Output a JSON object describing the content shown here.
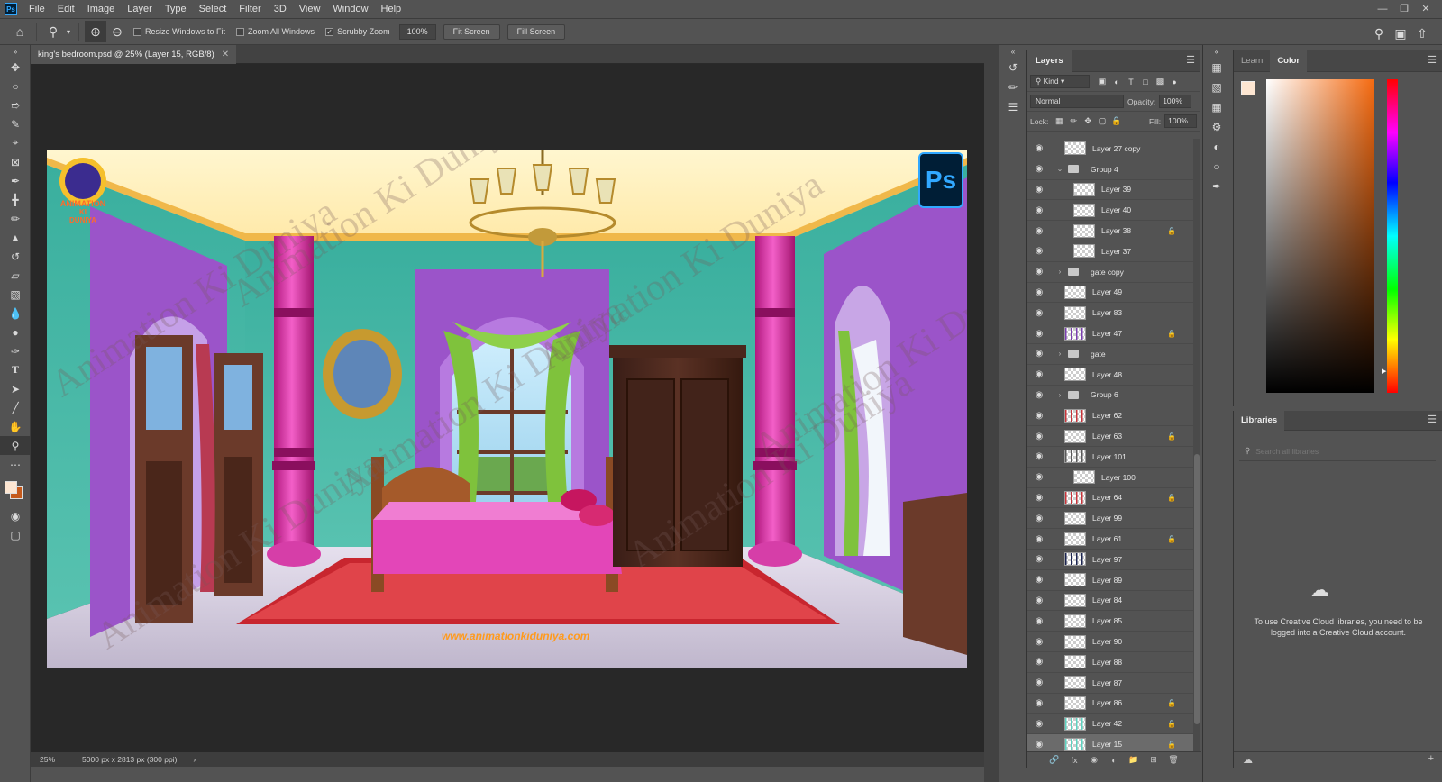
{
  "app": {
    "logo_text": "Ps"
  },
  "menu": [
    "File",
    "Edit",
    "Image",
    "Layer",
    "Type",
    "Select",
    "Filter",
    "3D",
    "View",
    "Window",
    "Help"
  ],
  "options": {
    "resize_windows": "Resize Windows to Fit",
    "zoom_all": "Zoom All Windows",
    "scrubby_zoom": "Scrubby Zoom",
    "zoom_value": "100%",
    "fit_screen": "Fit Screen",
    "fill_screen": "Fill Screen",
    "resize_checked": false,
    "zoom_all_checked": false,
    "scrubby_checked": true
  },
  "document": {
    "tab_title": "king's bedroom.psd @ 25% (Layer 15, RGB/8)",
    "status_zoom": "25%",
    "status_info": "5000 px x 2813 px (300 ppi)",
    "watermark_text": "Animation Ki Duniya",
    "ps_badge": "Ps",
    "site_url": "www.animationkiduniya.com",
    "logo_line1": "ANIMATION",
    "logo_line2": "KI",
    "logo_line3": "DUNIYA"
  },
  "layers_panel": {
    "title": "Layers",
    "filter_kind": "Kind",
    "blend_mode": "Normal",
    "opacity_label": "Opacity:",
    "opacity_value": "100%",
    "lock_label": "Lock:",
    "fill_label": "Fill:",
    "fill_value": "100%",
    "layers": [
      {
        "name": "Layer 27 copy",
        "type": "layer",
        "indent": 0,
        "locked": false,
        "selected": false,
        "thumb": "blank"
      },
      {
        "name": "Group 4",
        "type": "group",
        "expanded": true,
        "indent": 0,
        "locked": false,
        "selected": false
      },
      {
        "name": "Layer 39",
        "type": "layer",
        "indent": 1,
        "locked": false,
        "selected": false,
        "thumb": "blank"
      },
      {
        "name": "Layer 40",
        "type": "layer",
        "indent": 1,
        "locked": false,
        "selected": false,
        "thumb": "blank"
      },
      {
        "name": "Layer 38",
        "type": "layer",
        "indent": 1,
        "locked": true,
        "selected": false,
        "thumb": "blank"
      },
      {
        "name": "Layer 37",
        "type": "layer",
        "indent": 1,
        "locked": false,
        "selected": false,
        "thumb": "blank"
      },
      {
        "name": "gate copy",
        "type": "group",
        "expanded": false,
        "indent": 0,
        "locked": false,
        "selected": false
      },
      {
        "name": "Layer 49",
        "type": "layer",
        "indent": 0,
        "locked": false,
        "selected": false,
        "thumb": "blank"
      },
      {
        "name": "Layer 83",
        "type": "layer",
        "indent": 0,
        "locked": false,
        "selected": false,
        "thumb": "blank"
      },
      {
        "name": "Layer 47",
        "type": "layer",
        "indent": 0,
        "locked": true,
        "selected": false,
        "thumb": "purple"
      },
      {
        "name": "gate",
        "type": "group",
        "expanded": false,
        "indent": 0,
        "locked": false,
        "selected": false
      },
      {
        "name": "Layer 48",
        "type": "layer",
        "indent": 0,
        "locked": false,
        "selected": false,
        "thumb": "blank"
      },
      {
        "name": "Group 6",
        "type": "group",
        "expanded": false,
        "indent": 0,
        "locked": false,
        "selected": false
      },
      {
        "name": "Layer 62",
        "type": "layer",
        "indent": 0,
        "locked": false,
        "selected": false,
        "thumb": "red"
      },
      {
        "name": "Layer 63",
        "type": "layer",
        "indent": 0,
        "locked": true,
        "selected": false,
        "thumb": "blank"
      },
      {
        "name": "Layer 101",
        "type": "layer",
        "indent": 0,
        "locked": false,
        "selected": false,
        "thumb": "dark"
      },
      {
        "name": "Layer 100",
        "type": "layer",
        "indent": 1,
        "locked": false,
        "selected": false,
        "thumb": "blank"
      },
      {
        "name": "Layer 64",
        "type": "layer",
        "indent": 0,
        "locked": true,
        "selected": false,
        "thumb": "red"
      },
      {
        "name": "Layer 99",
        "type": "layer",
        "indent": 0,
        "locked": false,
        "selected": false,
        "thumb": "blank"
      },
      {
        "name": "Layer 61",
        "type": "layer",
        "indent": 0,
        "locked": true,
        "selected": false,
        "thumb": "blank"
      },
      {
        "name": "Layer 97",
        "type": "layer",
        "indent": 0,
        "locked": false,
        "selected": false,
        "thumb": "navy"
      },
      {
        "name": "Layer 89",
        "type": "layer",
        "indent": 0,
        "locked": false,
        "selected": false,
        "thumb": "blank"
      },
      {
        "name": "Layer 84",
        "type": "layer",
        "indent": 0,
        "locked": false,
        "selected": false,
        "thumb": "blank"
      },
      {
        "name": "Layer 85",
        "type": "layer",
        "indent": 0,
        "locked": false,
        "selected": false,
        "thumb": "blank"
      },
      {
        "name": "Layer 90",
        "type": "layer",
        "indent": 0,
        "locked": false,
        "selected": false,
        "thumb": "blank"
      },
      {
        "name": "Layer 88",
        "type": "layer",
        "indent": 0,
        "locked": false,
        "selected": false,
        "thumb": "blank"
      },
      {
        "name": "Layer 87",
        "type": "layer",
        "indent": 0,
        "locked": false,
        "selected": false,
        "thumb": "blank"
      },
      {
        "name": "Layer 86",
        "type": "layer",
        "indent": 0,
        "locked": true,
        "selected": false,
        "thumb": "blank"
      },
      {
        "name": "Layer 42",
        "type": "layer",
        "indent": 0,
        "locked": true,
        "selected": false,
        "thumb": "teal"
      },
      {
        "name": "Layer 15",
        "type": "layer",
        "indent": 0,
        "locked": true,
        "selected": true,
        "thumb": "teal"
      }
    ]
  },
  "color_panel": {
    "tab_learn": "Learn",
    "tab_color": "Color",
    "foreground": "#fde6d2",
    "background": "#c55a1c",
    "hue_color": "#f56a10"
  },
  "libraries_panel": {
    "title": "Libraries",
    "search_placeholder": "Search all libraries",
    "message": "To use Creative Cloud libraries, you need to be logged into a Creative Cloud account."
  }
}
